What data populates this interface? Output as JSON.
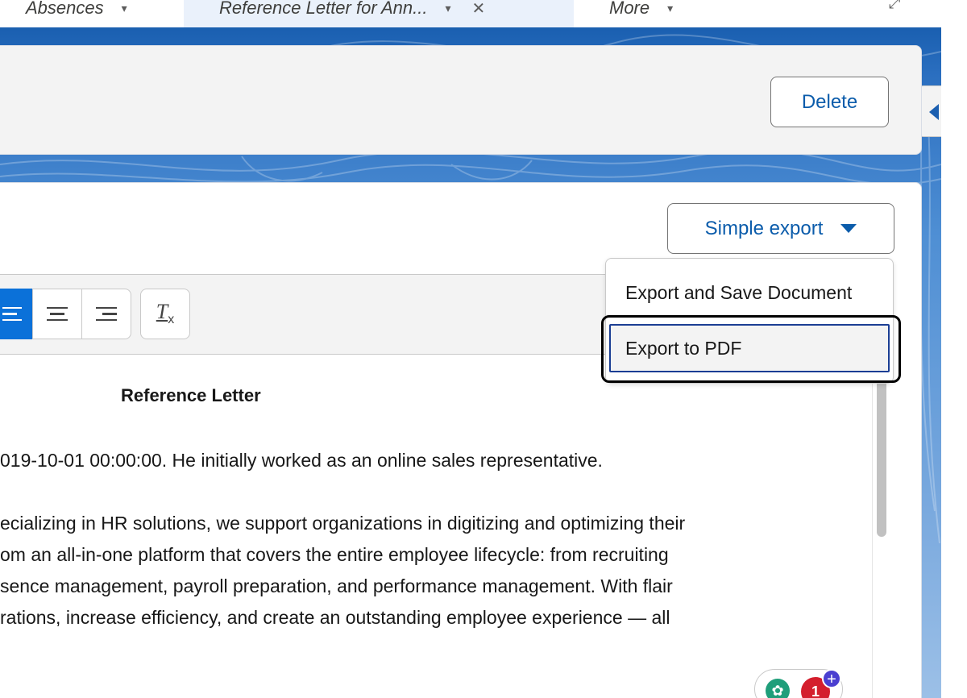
{
  "tabs": {
    "absences": "Absences",
    "active": "Reference Letter for Ann...",
    "more": "More"
  },
  "header": {
    "delete_label": "Delete"
  },
  "export": {
    "button_label": "Simple export",
    "menu": {
      "save": "Export and Save Document",
      "pdf": "Export to PDF"
    }
  },
  "document": {
    "title": "Reference Letter",
    "lines": [
      "019-10-01 00:00:00. He initially worked as an online sales representative.",
      "ecializing in HR solutions, we support organizations in digitizing and optimizing their",
      "om an all-in-one platform that covers the entire employee lifecycle: from recruiting",
      "sence management, payroll preparation, and performance management. With flair",
      "rations, increase efficiency, and create an outstanding employee experience — all"
    ]
  },
  "widgets": {
    "red_badge": "1",
    "plus": "+"
  },
  "colors": {
    "accent": "#0b5cab",
    "brand_blue": "#1a5fb0",
    "active_toolbar": "#0b71d9"
  }
}
